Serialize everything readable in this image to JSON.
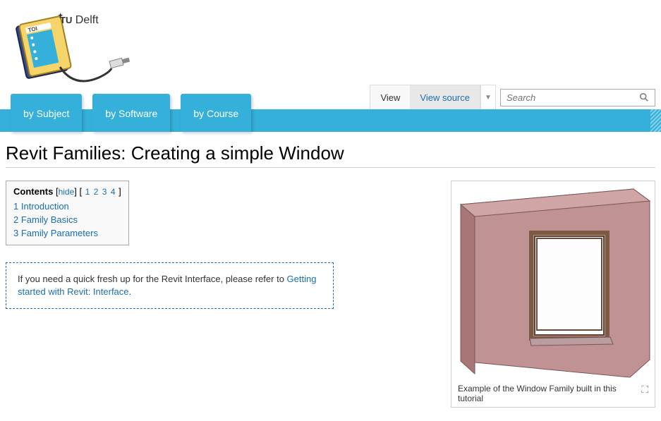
{
  "logo": {
    "brand": "Delft",
    "brand_prefix": "TU"
  },
  "nav": {
    "tabs": [
      "by Subject",
      "by Software",
      "by Course"
    ]
  },
  "views": {
    "view": "View",
    "source": "View source"
  },
  "search": {
    "placeholder": "Search"
  },
  "page": {
    "title": "Revit Families: Creating a simple Window"
  },
  "toc": {
    "title": "Contents",
    "toggle": "hide",
    "pages": [
      "1",
      "2",
      "3",
      "4"
    ],
    "items": [
      {
        "num": "1",
        "label": "Introduction"
      },
      {
        "num": "2",
        "label": "Family Basics"
      },
      {
        "num": "3",
        "label": "Family Parameters"
      }
    ]
  },
  "note": {
    "text_before": "If you need a quick fresh up for the Revit Interface, please refer to ",
    "link": "Getting started with Revit: Interface",
    "text_after": "."
  },
  "figure": {
    "caption": "Example of the Window Family built in this tutorial"
  }
}
